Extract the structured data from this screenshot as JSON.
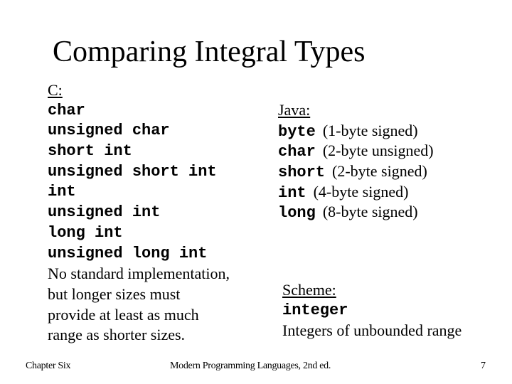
{
  "slide": {
    "title": "Comparing Integral Types",
    "c_section": {
      "heading": "C:",
      "types": [
        "char",
        "unsigned char",
        "short int",
        "unsigned short int",
        "int",
        "unsigned int",
        "long int",
        "unsigned long int"
      ],
      "note_lines": [
        "No standard implementation,",
        "but longer sizes must",
        "provide at least as much",
        "range as shorter sizes."
      ]
    },
    "java_section": {
      "heading": "Java:",
      "types": [
        {
          "name": "byte",
          "desc": "(1-byte signed)"
        },
        {
          "name": "char",
          "desc": "(2-byte unsigned)"
        },
        {
          "name": "short",
          "desc": "(2-byte signed)"
        },
        {
          "name": "int",
          "desc": "(4-byte signed)"
        },
        {
          "name": "long",
          "desc": "(8-byte signed)"
        }
      ]
    },
    "scheme_section": {
      "heading": "Scheme:",
      "type": "integer",
      "desc": "Integers of unbounded range"
    }
  },
  "footer": {
    "left": "Chapter Six",
    "center": "Modern Programming Languages, 2nd ed.",
    "page_number": "7"
  }
}
